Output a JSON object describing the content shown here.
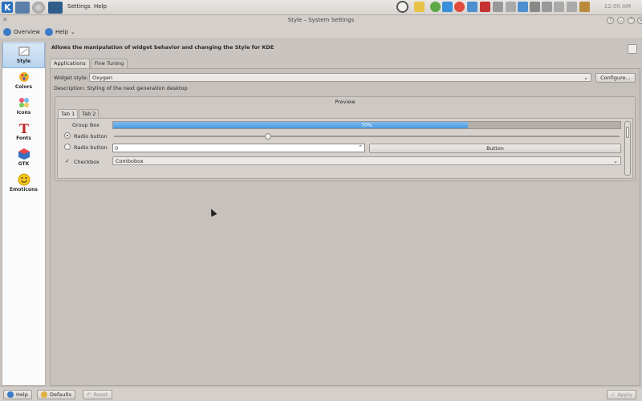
{
  "panel": {
    "menus": [
      "Settings",
      "Help"
    ],
    "clock": "12:00 AM"
  },
  "window": {
    "title": "Style – System Settings"
  },
  "toolbar": {
    "overview_label": "Overview",
    "help_label": "Help"
  },
  "sidebar": {
    "items": [
      {
        "label": "Style",
        "icon": "style-icon",
        "active": true
      },
      {
        "label": "Colors",
        "icon": "colors-icon",
        "active": false
      },
      {
        "label": "Icons",
        "icon": "icons-icon",
        "active": false
      },
      {
        "label": "Fonts",
        "icon": "fonts-icon",
        "active": false
      },
      {
        "label": "GTK",
        "icon": "gtk-icon",
        "active": false
      },
      {
        "label": "Emoticons",
        "icon": "emoticons-icon",
        "active": false
      }
    ]
  },
  "main": {
    "heading": "Allows the manipulation of widget behavior and changing the Style for KDE",
    "tabs": [
      "Applications",
      "Fine Tuning"
    ],
    "widget_style_label": "Widget style:",
    "widget_style_value": "Oxygen",
    "configure_label": "Configure...",
    "description": "Description: Styling of the next generation desktop",
    "preview": {
      "title": "Preview",
      "tabs": [
        "Tab 1",
        "Tab 2"
      ],
      "group_box": "Group Box",
      "radio1": "Radio button",
      "radio2": "Radio button",
      "checkbox": "Checkbox",
      "progress_text": "70%",
      "progress_value": 70,
      "spin_value": "0",
      "button_label": "Button",
      "combobox_label": "Combobox"
    }
  },
  "bottom": {
    "help_label": "Help",
    "defaults_label": "Defaults",
    "reset_label": "Reset",
    "apply_label": "Apply"
  }
}
